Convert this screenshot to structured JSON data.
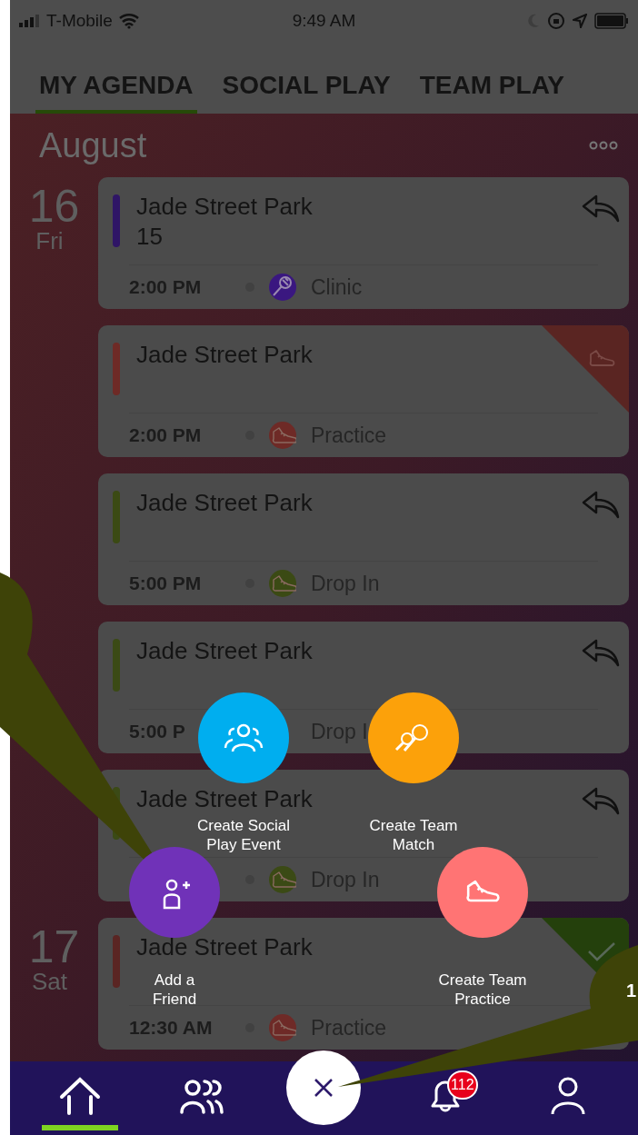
{
  "status_bar": {
    "carrier": "T-Mobile",
    "time": "9:49 AM"
  },
  "tabs": [
    {
      "label": "MY AGENDA",
      "selected": true
    },
    {
      "label": "SOCIAL PLAY",
      "selected": false
    },
    {
      "label": "TEAM PLAY",
      "selected": false
    }
  ],
  "month": "August",
  "days": [
    {
      "day": "16",
      "weekday": "Fri",
      "events": [
        {
          "title": "Jade Street Park",
          "subtitle": "15",
          "time": "2:00 PM",
          "type": "Clinic",
          "color": "#2f1566",
          "type_icon": {
            "kind": "racket",
            "color": "#3a1780"
          },
          "corner": {
            "kind": "reply"
          }
        },
        {
          "title": "Jade Street Park",
          "time": "2:00 PM",
          "type": "Practice",
          "color": "#6e2a26",
          "type_icon": {
            "kind": "shoe",
            "color": "#6e2a26"
          },
          "corner": {
            "kind": "shoe",
            "color": "#5a2522"
          }
        },
        {
          "title": "Jade Street Park",
          "time": "5:00 PM",
          "type": "Drop In",
          "color": "#3b4a14",
          "type_icon": {
            "kind": "shoe",
            "color": "#3b4a14"
          },
          "corner": {
            "kind": "reply"
          }
        },
        {
          "title": "Jade Street Park",
          "time": "5:00 P",
          "type": "Drop I",
          "color": "#3b4a15",
          "corner": {
            "kind": "reply"
          }
        },
        {
          "title": "Jade Street Park",
          "type": "Drop In",
          "color": "#3b4a16",
          "type_icon": {
            "kind": "shoe",
            "color": "#3b4a15"
          },
          "corner": {
            "kind": "reply"
          }
        }
      ]
    },
    {
      "day": "17",
      "weekday": "Sat",
      "events": [
        {
          "title": "Jade Street Park",
          "time": "12:30 AM",
          "type": "Practice",
          "color": "#5a2523",
          "type_icon": {
            "kind": "shoe",
            "color": "#6e2a27"
          },
          "corner": {
            "kind": "check",
            "color": "#24400c"
          }
        }
      ]
    }
  ],
  "actions": [
    {
      "label": "Create Social\nPlay Event",
      "kind": "people",
      "color": "#00aeef"
    },
    {
      "label": "Create Team\nMatch",
      "kind": "rackets",
      "color": "#fca10a"
    },
    {
      "label": "Add a\nFriend",
      "kind": "add_friend",
      "color": "#7032b8"
    },
    {
      "label": "Create Team\nPractice",
      "kind": "shoe",
      "color": "#ff7474"
    }
  ],
  "nav": [
    {
      "kind": "home",
      "selected": true
    },
    {
      "kind": "groups",
      "selected": false
    },
    {
      "kind": "close"
    },
    {
      "kind": "bell",
      "selected": false,
      "badge": "112"
    },
    {
      "kind": "profile",
      "selected": false
    }
  ],
  "callout_text": "1"
}
